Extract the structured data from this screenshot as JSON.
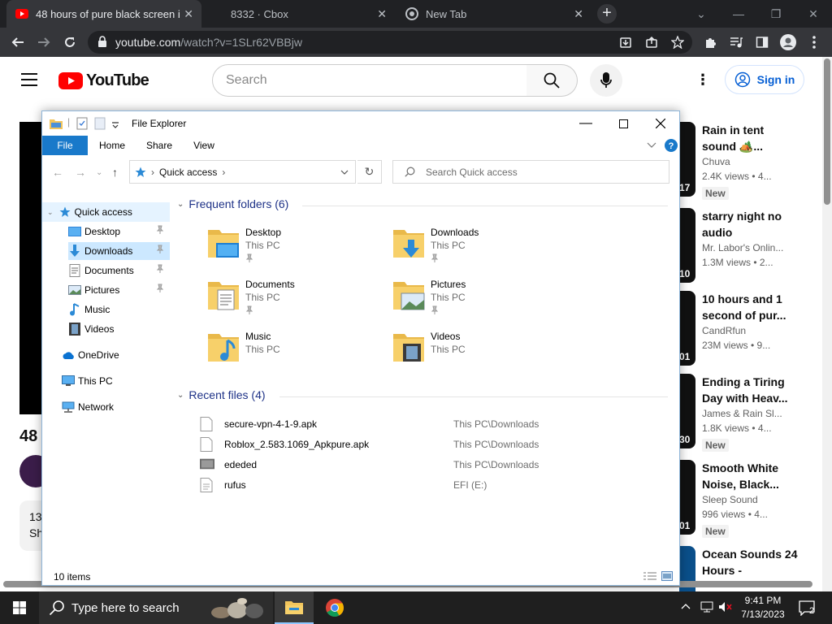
{
  "browser": {
    "tabs": [
      {
        "title": "48 hours of pure black screen in ",
        "active": true
      },
      {
        "title": "8332 · Cbox",
        "active": false
      },
      {
        "title": "New Tab",
        "active": false
      }
    ],
    "close_glyph": "✕",
    "new_tab_glyph": "+",
    "address": {
      "domain": "youtube.com",
      "path": "/watch?v=1SLr62VBBjw"
    }
  },
  "youtube": {
    "logo_text": "YouTube",
    "search_placeholder": "Search",
    "signin_label": "Sign in",
    "title_fragment": "48",
    "desc_line1": "13",
    "desc_line2": "Sh",
    "brand_red": "#ff0000",
    "recommendations": [
      {
        "title": "Rain in tent sound 🏕️...",
        "channel": "Chuva",
        "stats": "2.4K views • 4...",
        "badge": "New",
        "thumb_text": "17"
      },
      {
        "title": "starry night no audio",
        "channel": "Mr. Labor's Onlin...",
        "stats": "1.3M views • 2...",
        "badge": "",
        "thumb_text": "10"
      },
      {
        "title": "10 hours and 1 second of pur...",
        "channel": "CandRfun",
        "stats": "23M views • 9...",
        "badge": "",
        "thumb_text": "01"
      },
      {
        "title": "Ending a Tiring Day with Heav...",
        "channel": "James & Rain Sl...",
        "stats": "1.8K views • 4...",
        "badge": "New",
        "thumb_text": "30"
      },
      {
        "title": "Smooth White Noise, Black...",
        "channel": "Sleep Sound",
        "stats": "996 views • 4...",
        "badge": "New",
        "thumb_text": "01"
      },
      {
        "title": "Ocean Sounds 24 Hours -",
        "channel": "",
        "stats": "",
        "badge": "",
        "thumb_text": ""
      }
    ]
  },
  "explorer": {
    "title": "File Explorer",
    "ribbon_tabs": [
      "File",
      "Home",
      "Share",
      "View"
    ],
    "address_crumbs": [
      "Quick access"
    ],
    "search_placeholder": "Search Quick access",
    "nav": {
      "quick_access": "Quick access",
      "pinned": [
        "Desktop",
        "Downloads",
        "Documents",
        "Pictures",
        "Music",
        "Videos"
      ],
      "onedrive": "OneDrive",
      "this_pc": "This PC",
      "network": "Network"
    },
    "frequent_header": "Frequent folders (6)",
    "frequent": [
      {
        "name": "Desktop",
        "location": "This PC",
        "pinned": true
      },
      {
        "name": "Downloads",
        "location": "This PC",
        "pinned": true
      },
      {
        "name": "Documents",
        "location": "This PC",
        "pinned": true
      },
      {
        "name": "Pictures",
        "location": "This PC",
        "pinned": true
      },
      {
        "name": "Music",
        "location": "This PC",
        "pinned": false
      },
      {
        "name": "Videos",
        "location": "This PC",
        "pinned": false
      }
    ],
    "recent_header": "Recent files (4)",
    "recent": [
      {
        "name": "secure-vpn-4-1-9.apk",
        "path": "This PC\\Downloads"
      },
      {
        "name": "Roblox_2.583.1069_Apkpure.apk",
        "path": "This PC\\Downloads"
      },
      {
        "name": "ededed",
        "path": "This PC\\Downloads"
      },
      {
        "name": "rufus",
        "path": "EFI (E:)"
      }
    ],
    "status_count": "10 items",
    "accent": "#1979ca"
  },
  "taskbar": {
    "search_placeholder": "Type here to search",
    "time": "9:41 PM",
    "date": "7/13/2023",
    "notification_count": "2"
  }
}
